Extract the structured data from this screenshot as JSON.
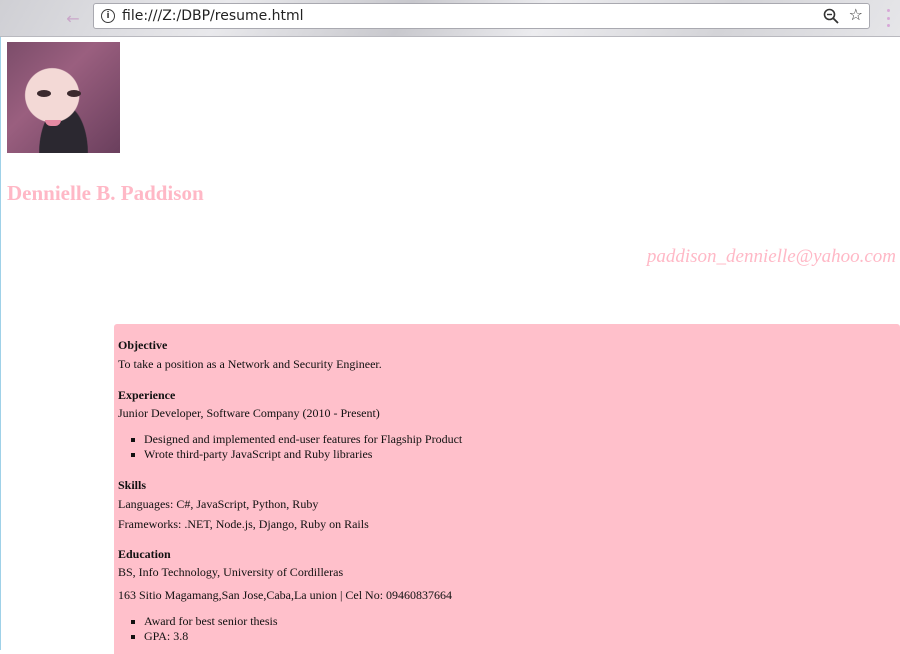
{
  "browser": {
    "url": "file:///Z:/DBP/resume.html",
    "icons": {
      "back": "back-arrow-icon",
      "info": "info-icon",
      "zoom": "zoom-icon",
      "bookmark": "star-icon",
      "menu": "menu-icon"
    }
  },
  "profile": {
    "name": "Dennielle B. Paddison",
    "email": "paddison_dennielle@yahoo.com"
  },
  "resume": {
    "objective": {
      "title": "Objective",
      "text": "To take a position as a Network and Security Engineer."
    },
    "experience": {
      "title": "Experience",
      "role": "Junior Developer, Software Company (2010 - Present)",
      "bullets": [
        "Designed and implemented end-user features for Flagship Product",
        "Wrote third-party JavaScript and Ruby libraries"
      ]
    },
    "skills": {
      "title": "Skills",
      "languages": "Languages: C#, JavaScript, Python, Ruby",
      "frameworks": "Frameworks: .NET, Node.js, Django, Ruby on Rails"
    },
    "education": {
      "title": "Education",
      "degree": "BS, Info Technology, University of Cordilleras",
      "contact": "163 Sitio Magamang,San Jose,Caba,La union | Cel No: 09460837664",
      "bullets": [
        "Award for best senior thesis",
        "GPA: 3.8"
      ]
    }
  },
  "colors": {
    "accent_pink": "#ffb8c6",
    "resume_background": "#ffc0cb"
  }
}
